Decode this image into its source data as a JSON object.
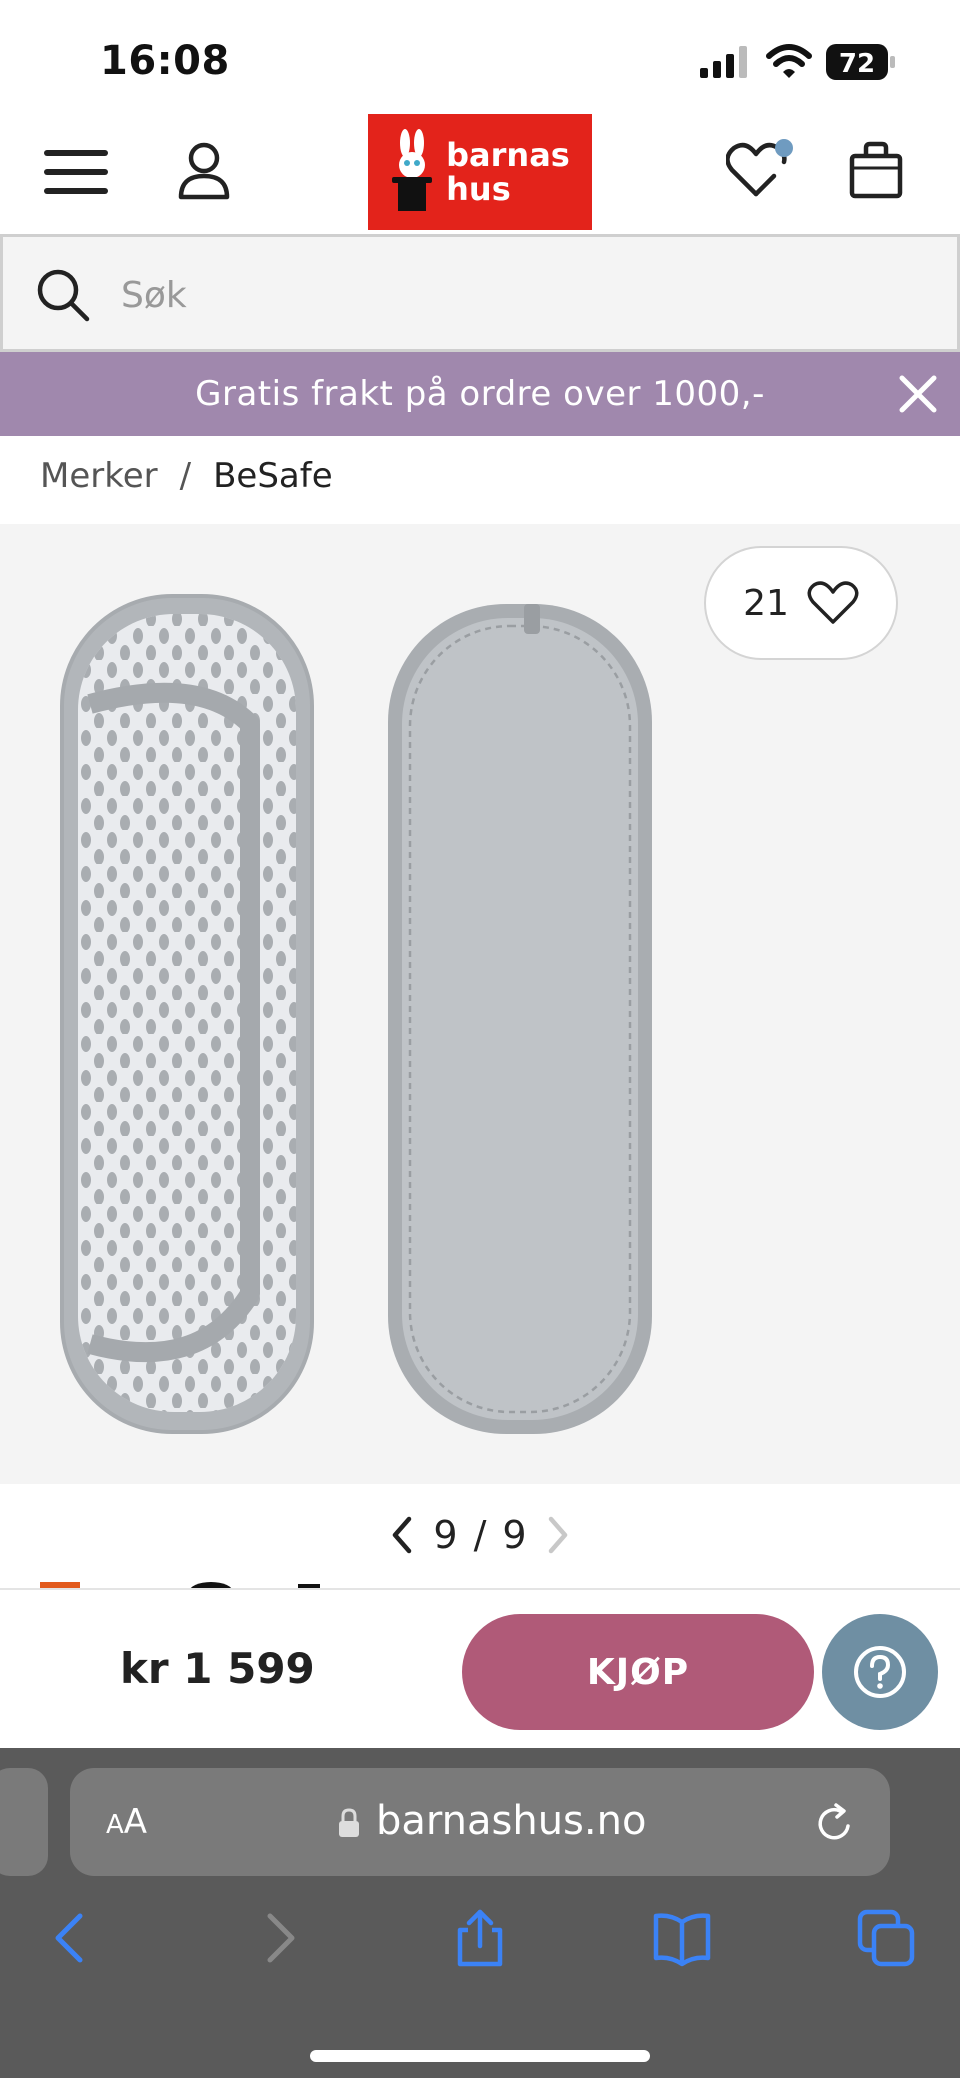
{
  "status_bar": {
    "time": "16:08",
    "battery": "72"
  },
  "header": {
    "logo_line1": "barnas",
    "logo_line2": "hus"
  },
  "search": {
    "placeholder": "Søk"
  },
  "promo": {
    "text": "Gratis frakt på ordre over 1000,-"
  },
  "breadcrumb": {
    "items": [
      "Merker",
      "BeSafe"
    ],
    "separator": "/"
  },
  "gallery": {
    "favorites_count": "21",
    "current": "9",
    "separator": "/",
    "total": "9"
  },
  "buy_bar": {
    "price": "kr 1 599",
    "buy_label": "KJØP"
  },
  "browser": {
    "aa_small": "A",
    "aa_large": "A",
    "url": "barnashus.no"
  },
  "colors": {
    "logo_red": "#e3231b",
    "promo_purple": "#a088ad",
    "buy_pink": "#b05a78",
    "help_blue": "#6f8fa3",
    "ios_blue": "#3b82f6",
    "wishlist_dot": "#6f9bc0"
  },
  "icons": [
    "menu-icon",
    "user-icon",
    "heart-icon",
    "bag-icon",
    "search-icon",
    "close-icon",
    "chevron-left-icon",
    "chevron-right-icon",
    "help-icon",
    "lock-icon",
    "reload-icon",
    "back-icon",
    "forward-icon",
    "share-icon",
    "bookmarks-icon",
    "tabs-icon"
  ]
}
